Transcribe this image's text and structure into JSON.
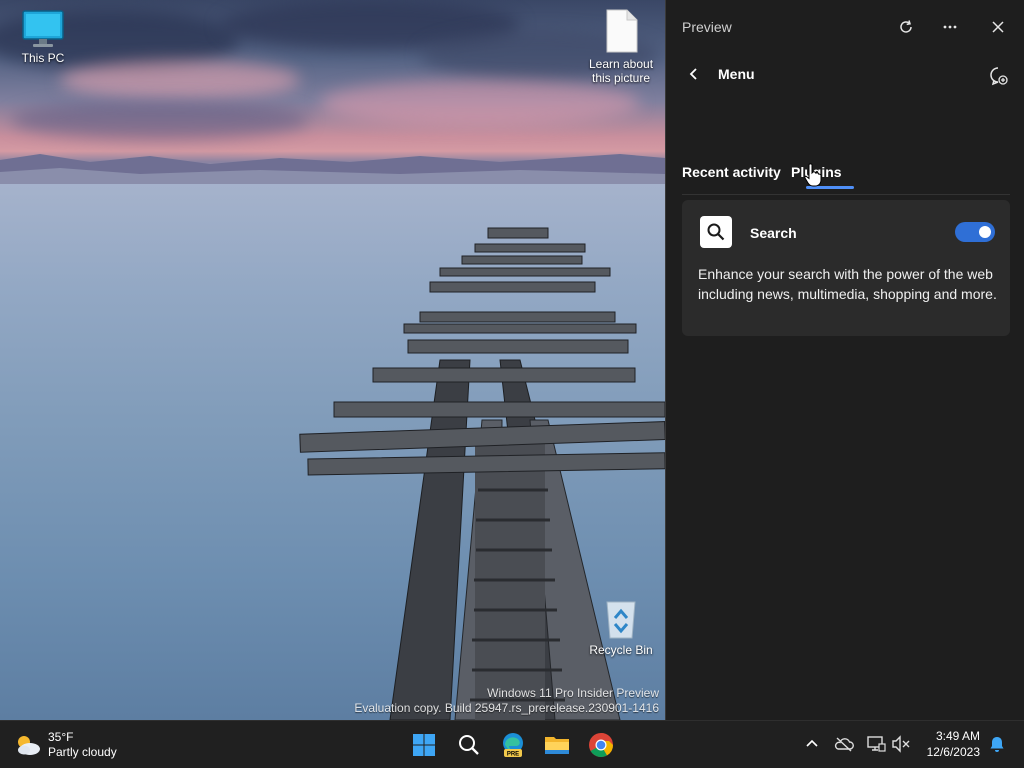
{
  "desktop": {
    "icons": [
      {
        "label": "This PC",
        "icon": "monitor-icon"
      },
      {
        "label": "Learn about this picture",
        "icon": "document-icon"
      },
      {
        "label": "Recycle Bin",
        "icon": "recycle-bin-icon"
      }
    ],
    "watermark": {
      "line1": "Windows 11 Pro Insider Preview",
      "line2": "Evaluation copy. Build 25947.rs_prerelease.230901-1416"
    }
  },
  "panel": {
    "title": "Preview",
    "menu_label": "Menu",
    "tabs": [
      {
        "label": "Recent activity",
        "active": false
      },
      {
        "label": "Plugins",
        "active": true
      }
    ],
    "plugin": {
      "name": "Search",
      "enabled": true,
      "description": "Enhance your search with the power of the web including news, multimedia, shopping and more."
    },
    "icons": [
      "refresh-icon",
      "more-icon",
      "close-icon",
      "back-icon",
      "new-chat-icon",
      "search-icon"
    ]
  },
  "taskbar": {
    "weather": {
      "temperature": "35°F",
      "condition": "Partly cloudy"
    },
    "apps": [
      "start-icon",
      "search-icon",
      "edge-pre-icon",
      "file-explorer-icon",
      "chrome-icon"
    ],
    "tray": [
      "chevron-up-icon",
      "onedrive-icon",
      "network-icon",
      "volume-muted-icon",
      "notification-bell-icon"
    ],
    "clock": {
      "time": "3:49 AM",
      "date": "12/6/2023"
    }
  },
  "colors": {
    "accent": "#4f8ff7",
    "toggle_on": "#2f6fd6",
    "panel_bg": "#1e1e1e",
    "card_bg": "#2b2b2b",
    "taskbar_bg": "#202020"
  }
}
